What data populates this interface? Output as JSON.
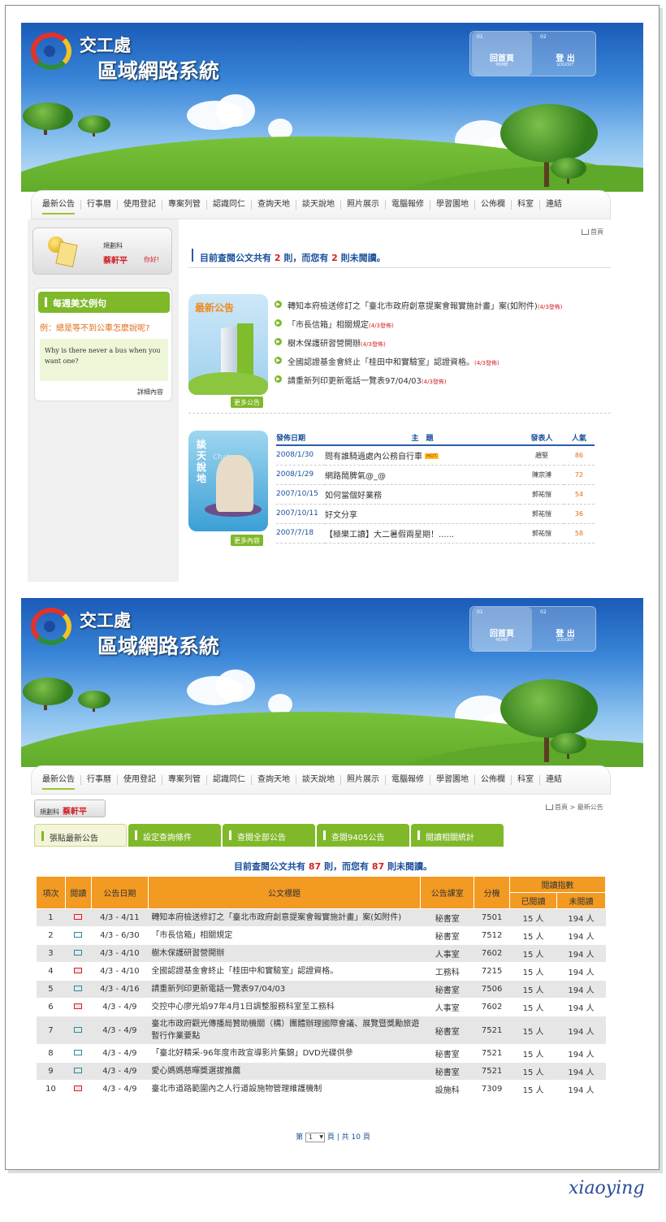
{
  "header": {
    "org": "交工處",
    "system": "區域網路系統",
    "home_no": "01",
    "home_label": "回首頁",
    "home_sub": "HOME",
    "logout_no": "02",
    "logout_label": "登 出",
    "logout_sub": "LOGOUT"
  },
  "nav": [
    "最新公告",
    "行事曆",
    "使用登記",
    "專案列管",
    "認識同仁",
    "查詢天地",
    "談天說地",
    "照片展示",
    "電腦報修",
    "學習園地",
    "公佈欄",
    "科室",
    "連結"
  ],
  "page1": {
    "user": {
      "dept": "規劃科",
      "name": "蔡軒平",
      "greeting": "你好!"
    },
    "english": {
      "title": "每週美文例句",
      "question": "例：總是等不到公車怎麼說呢?",
      "answer": "Why is there never a bus when you want one?",
      "more": "詳細內容"
    },
    "breadcrumb": "首頁",
    "notice": {
      "pre": "目前查閱公文共有 ",
      "total": "2",
      "mid": " 則，而您有 ",
      "unread": "2",
      "post": " 則未閱讀。"
    },
    "news": {
      "card_title": "最新公告",
      "more": "更多公告",
      "items": [
        {
          "title": "轉知本府檢送修訂之「臺北市政府創意提案會報實施計畫」案(如附件)",
          "tag": "(4/3發佈)"
        },
        {
          "title": "「市長信箱」相關規定",
          "tag": "(4/3發佈)"
        },
        {
          "title": "樹木保護研習營開辦",
          "tag": "(4/3發佈)"
        },
        {
          "title": "全國認證基金會終止「桂田中和實驗室」認證資格。",
          "tag": "(4/3發佈)"
        },
        {
          "title": "請重新列印更新電話一覽表97/04/03",
          "tag": "(4/3發佈)"
        }
      ]
    },
    "chat": {
      "card_title": "談天說地",
      "card_sub": "Chat",
      "more": "更多內容",
      "headers": [
        "發佈日期",
        "主　題",
        "發表人",
        "人氣"
      ],
      "hot": "HOT",
      "rows": [
        {
          "date": "2008/1/30",
          "topic": "問有誰騎過處內公務自行車",
          "author": "趙堅",
          "views": "86",
          "hot": true
        },
        {
          "date": "2008/1/29",
          "topic": "網路鬧脾氣@_@",
          "author": "陳宗溥",
          "views": "72",
          "hot": false
        },
        {
          "date": "2007/10/15",
          "topic": "如何當個好業務",
          "author": "郭祐愷",
          "views": "54",
          "hot": false
        },
        {
          "date": "2007/10/11",
          "topic": "好文分享",
          "author": "郭祐愷",
          "views": "36",
          "hot": false
        },
        {
          "date": "2007/7/18",
          "topic": "【極樂工讀】大二暑假兩星期！......",
          "author": "郭祐愷",
          "views": "58",
          "hot": false
        }
      ]
    }
  },
  "page2": {
    "user": {
      "dept": "規劃科",
      "name": "蔡軒平"
    },
    "breadcrumb": "首頁 > 最新公告",
    "tabs": [
      "張貼最新公告",
      "設定查詢條件",
      "查閱全部公告",
      "查閱9405公告",
      "閱讀相關統計"
    ],
    "notice": {
      "pre": "目前查閱公文共有 ",
      "total": "87",
      "mid": " 則，而您有 ",
      "unread": "87",
      "post": " 則未閱讀。"
    },
    "table": {
      "headers": [
        "項次",
        "閱讀",
        "公告日期",
        "公文標題",
        "公告課室",
        "分機",
        "閱讀指數",
        "已閱讀",
        "未閱讀"
      ],
      "rows": [
        {
          "no": "1",
          "read": false,
          "date": "4/3 - 4/11",
          "title": "轉知本府檢送修訂之「臺北市政府創意提案會報實施計畫」案(如附件)",
          "room": "秘書室",
          "ext": "7501",
          "readc": "15 人",
          "unreadc": "194 人"
        },
        {
          "no": "2",
          "read": true,
          "date": "4/3 - 6/30",
          "title": "「市長信箱」相關規定",
          "room": "秘書室",
          "ext": "7512",
          "readc": "15 人",
          "unreadc": "194 人"
        },
        {
          "no": "3",
          "read": true,
          "date": "4/3 - 4/10",
          "title": "樹木保護研習營開辦",
          "room": "人事室",
          "ext": "7602",
          "readc": "15 人",
          "unreadc": "194 人"
        },
        {
          "no": "4",
          "read": false,
          "date": "4/3 - 4/10",
          "title": "全國認證基金會終止「桂田中和實驗室」認證資格。",
          "room": "工務科",
          "ext": "7215",
          "readc": "15 人",
          "unreadc": "194 人"
        },
        {
          "no": "5",
          "read": true,
          "date": "4/3 - 4/16",
          "title": "請重新列印更新電話一覽表97/04/03",
          "room": "秘書室",
          "ext": "7506",
          "readc": "15 人",
          "unreadc": "194 人"
        },
        {
          "no": "6",
          "read": false,
          "date": "4/3 - 4/9",
          "title": "交控中心廖光焰97年4月1日調整服務科室至工務科",
          "room": "人事室",
          "ext": "7602",
          "readc": "15 人",
          "unreadc": "194 人"
        },
        {
          "no": "7",
          "read": true,
          "date": "4/3 - 4/9",
          "title": "臺北市政府觀光傳播局贊助機關（構）團體辦理國際會議、展覽暨獎勵旅遊暫行作業要點",
          "room": "秘書室",
          "ext": "7521",
          "readc": "15 人",
          "unreadc": "194 人"
        },
        {
          "no": "8",
          "read": true,
          "date": "4/3 - 4/9",
          "title": "「臺北好精采-96年度市政宣導影片集錦」DVD光碟供參",
          "room": "秘書室",
          "ext": "7521",
          "readc": "15 人",
          "unreadc": "194 人"
        },
        {
          "no": "9",
          "read": true,
          "date": "4/3 - 4/9",
          "title": "愛心媽媽慈暉獎選拔推薦",
          "room": "秘書室",
          "ext": "7521",
          "readc": "15 人",
          "unreadc": "194 人"
        },
        {
          "no": "10",
          "read": false,
          "date": "4/3 - 4/9",
          "title": "臺北市道路範圍內之人行道設施物管理維護機制",
          "room": "設施科",
          "ext": "7309",
          "readc": "15 人",
          "unreadc": "194 人"
        }
      ]
    },
    "pager": {
      "pre": "第",
      "page": "1",
      "mid": "頁 | 共",
      "total": "10",
      "post": "頁"
    }
  },
  "signature": "xiaoying"
}
